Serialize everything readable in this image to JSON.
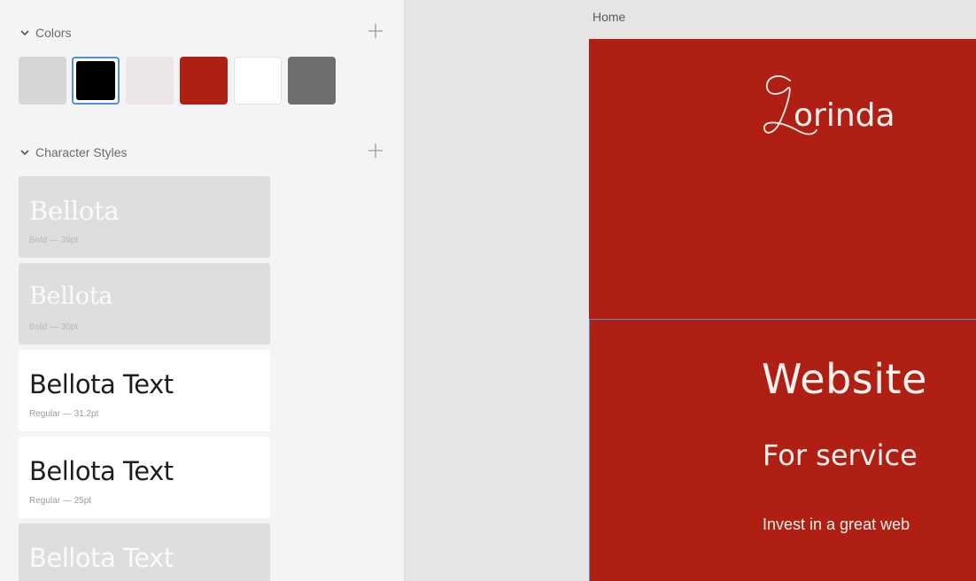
{
  "colors_section": {
    "title": "Colors",
    "swatches": [
      {
        "name": "light-gray",
        "hex": "#d6d6d6"
      },
      {
        "name": "black",
        "hex": "#000000"
      },
      {
        "name": "blush",
        "hex": "#ece6e6"
      },
      {
        "name": "red",
        "hex": "#b01f14"
      },
      {
        "name": "white",
        "hex": "#ffffff"
      },
      {
        "name": "dark-gray",
        "hex": "#6e6e6e"
      }
    ]
  },
  "character_styles": {
    "title": "Character Styles",
    "items": [
      {
        "font": "Bellota",
        "meta": "Bold — 39pt"
      },
      {
        "font": "Bellota",
        "meta": "Bold — 30pt"
      },
      {
        "font": "Bellota Text",
        "meta": "Regular — 31.2pt"
      },
      {
        "font": "Bellota Text",
        "meta": "Regular — 25pt"
      },
      {
        "font": "Bellota Text",
        "meta": ""
      }
    ]
  },
  "canvas": {
    "artboard_label": "Home",
    "brand": "Lorinda",
    "hero_title": "Website",
    "hero_subtitle": "For service",
    "hero_body": "Invest in a great web",
    "accent": "#b01f14",
    "selection_color": "#4a90e2"
  }
}
